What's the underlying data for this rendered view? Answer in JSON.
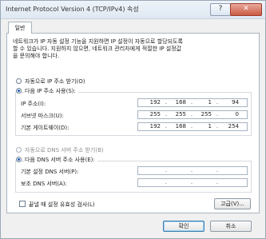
{
  "window": {
    "title": "Internet Protocol Version 4 (TCP/IPv4) 속성",
    "help_glyph": "?",
    "close_glyph": "✕"
  },
  "tab": {
    "label": "일반"
  },
  "description": {
    "line1": "네트워크가 IP 자동 설정 기능을 지원하면 IP 설정이 자동으로 할당되도록",
    "line2": "할 수 있습니다. 지원하지 않으면, 네트워크 관리자에게 적절한 IP 설정값",
    "line3": "을 문의해야 합니다."
  },
  "ip_section": {
    "auto_label": "자동으로 IP 주소 받기(O)",
    "manual_label": "다음 IP 주소 사용(S):",
    "auto_selected": false,
    "manual_selected": true,
    "fields": [
      {
        "label": "IP 주소(I):",
        "octets": [
          "192",
          "168",
          "1",
          "94"
        ]
      },
      {
        "label": "서브넷 마스크(U):",
        "octets": [
          "255",
          "255",
          "255",
          "0"
        ]
      },
      {
        "label": "기본 게이트웨이(D):",
        "octets": [
          "192",
          "168",
          "1",
          "254"
        ]
      }
    ]
  },
  "dns_section": {
    "auto_label": "자동으로 DNS 서버 주소 받기(B)",
    "manual_label": "다음 DNS 서버 주소 사용(E):",
    "auto_selected": false,
    "manual_selected": true,
    "fields": [
      {
        "label": "기본 설정 DNS 서버(P):",
        "octets": [
          "",
          "",
          "",
          ""
        ]
      },
      {
        "label": "보조 DNS 서버(A):",
        "octets": [
          "",
          "",
          "",
          ""
        ]
      }
    ]
  },
  "validate": {
    "label": "끝낼 때 설정 유효성 검사(L)",
    "checked": false
  },
  "buttons": {
    "advanced": "고급(V)...",
    "ok": "확인",
    "cancel": "취소"
  },
  "dot": "."
}
